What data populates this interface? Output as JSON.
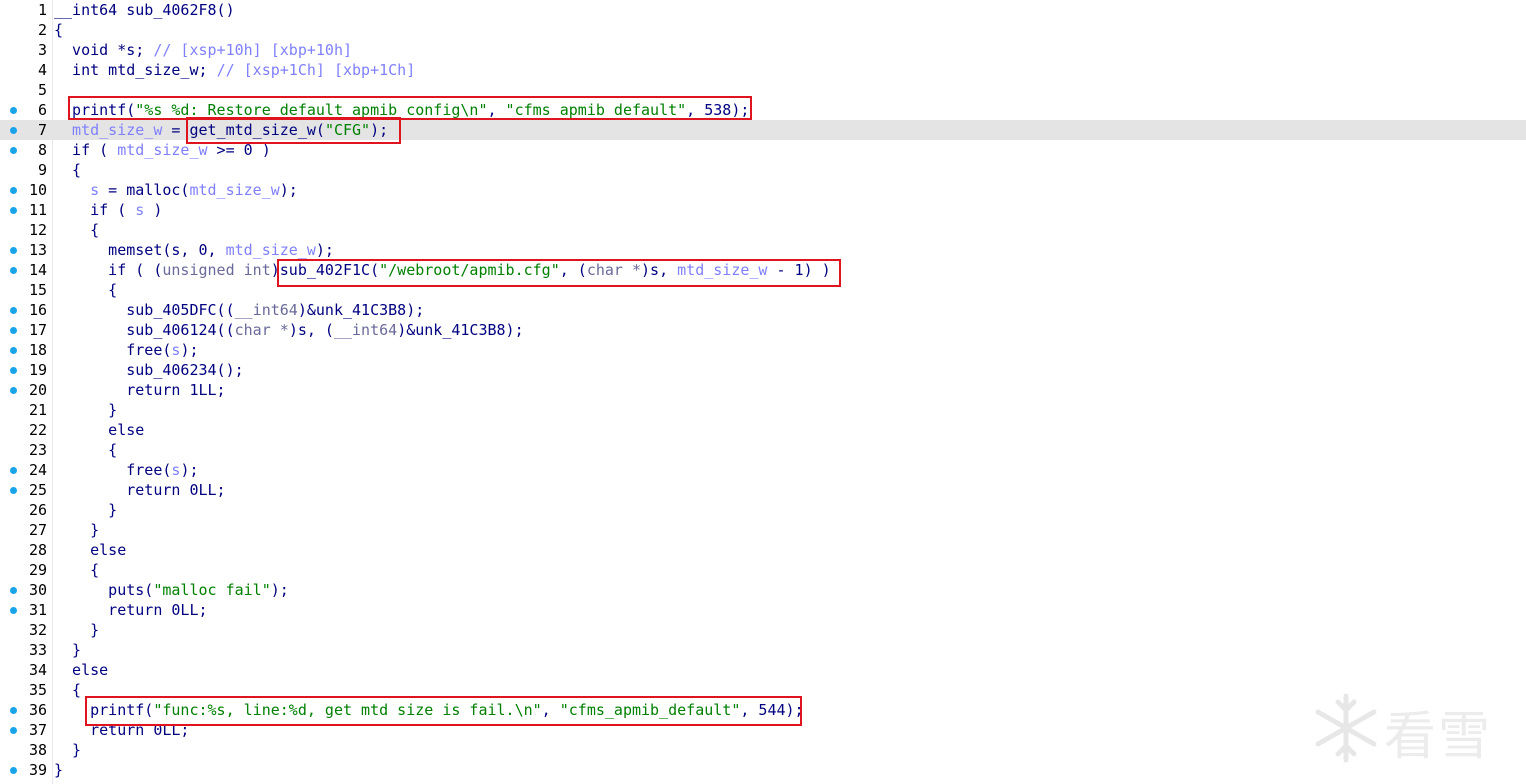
{
  "window": {
    "highlight_color": "#e4e4e4",
    "breakpoint_color": "#1aa3e8",
    "annotation_color": "#e0141e"
  },
  "code": {
    "lines": [
      {
        "n": "1",
        "bp": false,
        "hl": false,
        "t": [
          [
            "p",
            "__int64 sub_4062F8()"
          ]
        ]
      },
      {
        "n": "2",
        "bp": false,
        "hl": false,
        "t": [
          [
            "p",
            "{"
          ]
        ]
      },
      {
        "n": "3",
        "bp": false,
        "hl": false,
        "t": [
          [
            "p",
            "  void *s; "
          ],
          [
            "c",
            "// [xsp+10h] [xbp+10h]"
          ]
        ]
      },
      {
        "n": "4",
        "bp": false,
        "hl": false,
        "t": [
          [
            "p",
            "  int mtd_size_w; "
          ],
          [
            "c",
            "// [xsp+1Ch] [xbp+1Ch]"
          ]
        ]
      },
      {
        "n": "5",
        "bp": false,
        "hl": false,
        "t": [
          [
            "p",
            ""
          ]
        ]
      },
      {
        "n": "6",
        "bp": true,
        "hl": false,
        "t": [
          [
            "p",
            "  printf("
          ],
          [
            "s",
            "\"%s %d: Restore default apmib config\\n\""
          ],
          [
            "p",
            ", "
          ],
          [
            "s",
            "\"cfms_apmib_default\""
          ],
          [
            "p",
            ", 538);"
          ]
        ]
      },
      {
        "n": "7",
        "bp": true,
        "hl": true,
        "t": [
          [
            "v",
            "  mtd_size_w"
          ],
          [
            "p",
            " = get_mtd_size_w("
          ],
          [
            "s",
            "\"CFG\""
          ],
          [
            "p",
            ");"
          ]
        ]
      },
      {
        "n": "8",
        "bp": true,
        "hl": false,
        "t": [
          [
            "p",
            "  if ( "
          ],
          [
            "v",
            "mtd_size_w"
          ],
          [
            "p",
            " >= 0 )"
          ]
        ]
      },
      {
        "n": "9",
        "bp": false,
        "hl": false,
        "t": [
          [
            "p",
            "  {"
          ]
        ]
      },
      {
        "n": "10",
        "bp": true,
        "hl": false,
        "t": [
          [
            "v",
            "    s"
          ],
          [
            "p",
            " = malloc("
          ],
          [
            "v",
            "mtd_size_w"
          ],
          [
            "p",
            ");"
          ]
        ]
      },
      {
        "n": "11",
        "bp": true,
        "hl": false,
        "t": [
          [
            "p",
            "    if ( "
          ],
          [
            "v",
            "s"
          ],
          [
            "p",
            " )"
          ]
        ]
      },
      {
        "n": "12",
        "bp": false,
        "hl": false,
        "t": [
          [
            "p",
            "    {"
          ]
        ]
      },
      {
        "n": "13",
        "bp": true,
        "hl": false,
        "t": [
          [
            "p",
            "      memset(s, 0, "
          ],
          [
            "v",
            "mtd_size_w"
          ],
          [
            "p",
            ");"
          ]
        ]
      },
      {
        "n": "14",
        "bp": true,
        "hl": false,
        "t": [
          [
            "p",
            "      if ( ("
          ],
          [
            "y",
            "unsigned int"
          ],
          [
            "p",
            ")sub_402F1C("
          ],
          [
            "s",
            "\"/webroot/apmib.cfg\""
          ],
          [
            "p",
            ", ("
          ],
          [
            "y",
            "char *"
          ],
          [
            "p",
            ")s, "
          ],
          [
            "v",
            "mtd_size_w"
          ],
          [
            "p",
            " - 1) )"
          ]
        ]
      },
      {
        "n": "15",
        "bp": false,
        "hl": false,
        "t": [
          [
            "p",
            "      {"
          ]
        ]
      },
      {
        "n": "16",
        "bp": true,
        "hl": false,
        "t": [
          [
            "p",
            "        sub_405DFC(("
          ],
          [
            "y",
            "__int64"
          ],
          [
            "p",
            ")&unk_41C3B8);"
          ]
        ]
      },
      {
        "n": "17",
        "bp": true,
        "hl": false,
        "t": [
          [
            "p",
            "        sub_406124(("
          ],
          [
            "y",
            "char *"
          ],
          [
            "p",
            ")s, ("
          ],
          [
            "y",
            "__int64"
          ],
          [
            "p",
            ")&unk_41C3B8);"
          ]
        ]
      },
      {
        "n": "18",
        "bp": true,
        "hl": false,
        "t": [
          [
            "p",
            "        free("
          ],
          [
            "v",
            "s"
          ],
          [
            "p",
            ");"
          ]
        ]
      },
      {
        "n": "19",
        "bp": true,
        "hl": false,
        "t": [
          [
            "p",
            "        sub_406234();"
          ]
        ]
      },
      {
        "n": "20",
        "bp": true,
        "hl": false,
        "t": [
          [
            "p",
            "        return 1LL;"
          ]
        ]
      },
      {
        "n": "21",
        "bp": false,
        "hl": false,
        "t": [
          [
            "p",
            "      }"
          ]
        ]
      },
      {
        "n": "22",
        "bp": false,
        "hl": false,
        "t": [
          [
            "p",
            "      else"
          ]
        ]
      },
      {
        "n": "23",
        "bp": false,
        "hl": false,
        "t": [
          [
            "p",
            "      {"
          ]
        ]
      },
      {
        "n": "24",
        "bp": true,
        "hl": false,
        "t": [
          [
            "p",
            "        free("
          ],
          [
            "v",
            "s"
          ],
          [
            "p",
            ");"
          ]
        ]
      },
      {
        "n": "25",
        "bp": true,
        "hl": false,
        "t": [
          [
            "p",
            "        return 0LL;"
          ]
        ]
      },
      {
        "n": "26",
        "bp": false,
        "hl": false,
        "t": [
          [
            "p",
            "      }"
          ]
        ]
      },
      {
        "n": "27",
        "bp": false,
        "hl": false,
        "t": [
          [
            "p",
            "    }"
          ]
        ]
      },
      {
        "n": "28",
        "bp": false,
        "hl": false,
        "t": [
          [
            "p",
            "    else"
          ]
        ]
      },
      {
        "n": "29",
        "bp": false,
        "hl": false,
        "t": [
          [
            "p",
            "    {"
          ]
        ]
      },
      {
        "n": "30",
        "bp": true,
        "hl": false,
        "t": [
          [
            "p",
            "      puts("
          ],
          [
            "s",
            "\"malloc fail\""
          ],
          [
            "p",
            ");"
          ]
        ]
      },
      {
        "n": "31",
        "bp": true,
        "hl": false,
        "t": [
          [
            "p",
            "      return 0LL;"
          ]
        ]
      },
      {
        "n": "32",
        "bp": false,
        "hl": false,
        "t": [
          [
            "p",
            "    }"
          ]
        ]
      },
      {
        "n": "33",
        "bp": false,
        "hl": false,
        "t": [
          [
            "p",
            "  }"
          ]
        ]
      },
      {
        "n": "34",
        "bp": false,
        "hl": false,
        "t": [
          [
            "p",
            "  else"
          ]
        ]
      },
      {
        "n": "35",
        "bp": false,
        "hl": false,
        "t": [
          [
            "p",
            "  {"
          ]
        ]
      },
      {
        "n": "36",
        "bp": true,
        "hl": false,
        "t": [
          [
            "p",
            "    printf("
          ],
          [
            "s",
            "\"func:%s, line:%d, get mtd size is fail.\\n\""
          ],
          [
            "p",
            ", "
          ],
          [
            "s",
            "\"cfms_apmib_default\""
          ],
          [
            "p",
            ", 544);"
          ]
        ]
      },
      {
        "n": "37",
        "bp": true,
        "hl": false,
        "t": [
          [
            "p",
            "    return 0LL;"
          ]
        ]
      },
      {
        "n": "38",
        "bp": false,
        "hl": false,
        "t": [
          [
            "p",
            "  }"
          ]
        ]
      },
      {
        "n": "39",
        "bp": true,
        "hl": false,
        "t": [
          [
            "p",
            "}"
          ]
        ]
      }
    ]
  },
  "watermark": {
    "icon": "snowflake-icon",
    "text": "看雪"
  }
}
